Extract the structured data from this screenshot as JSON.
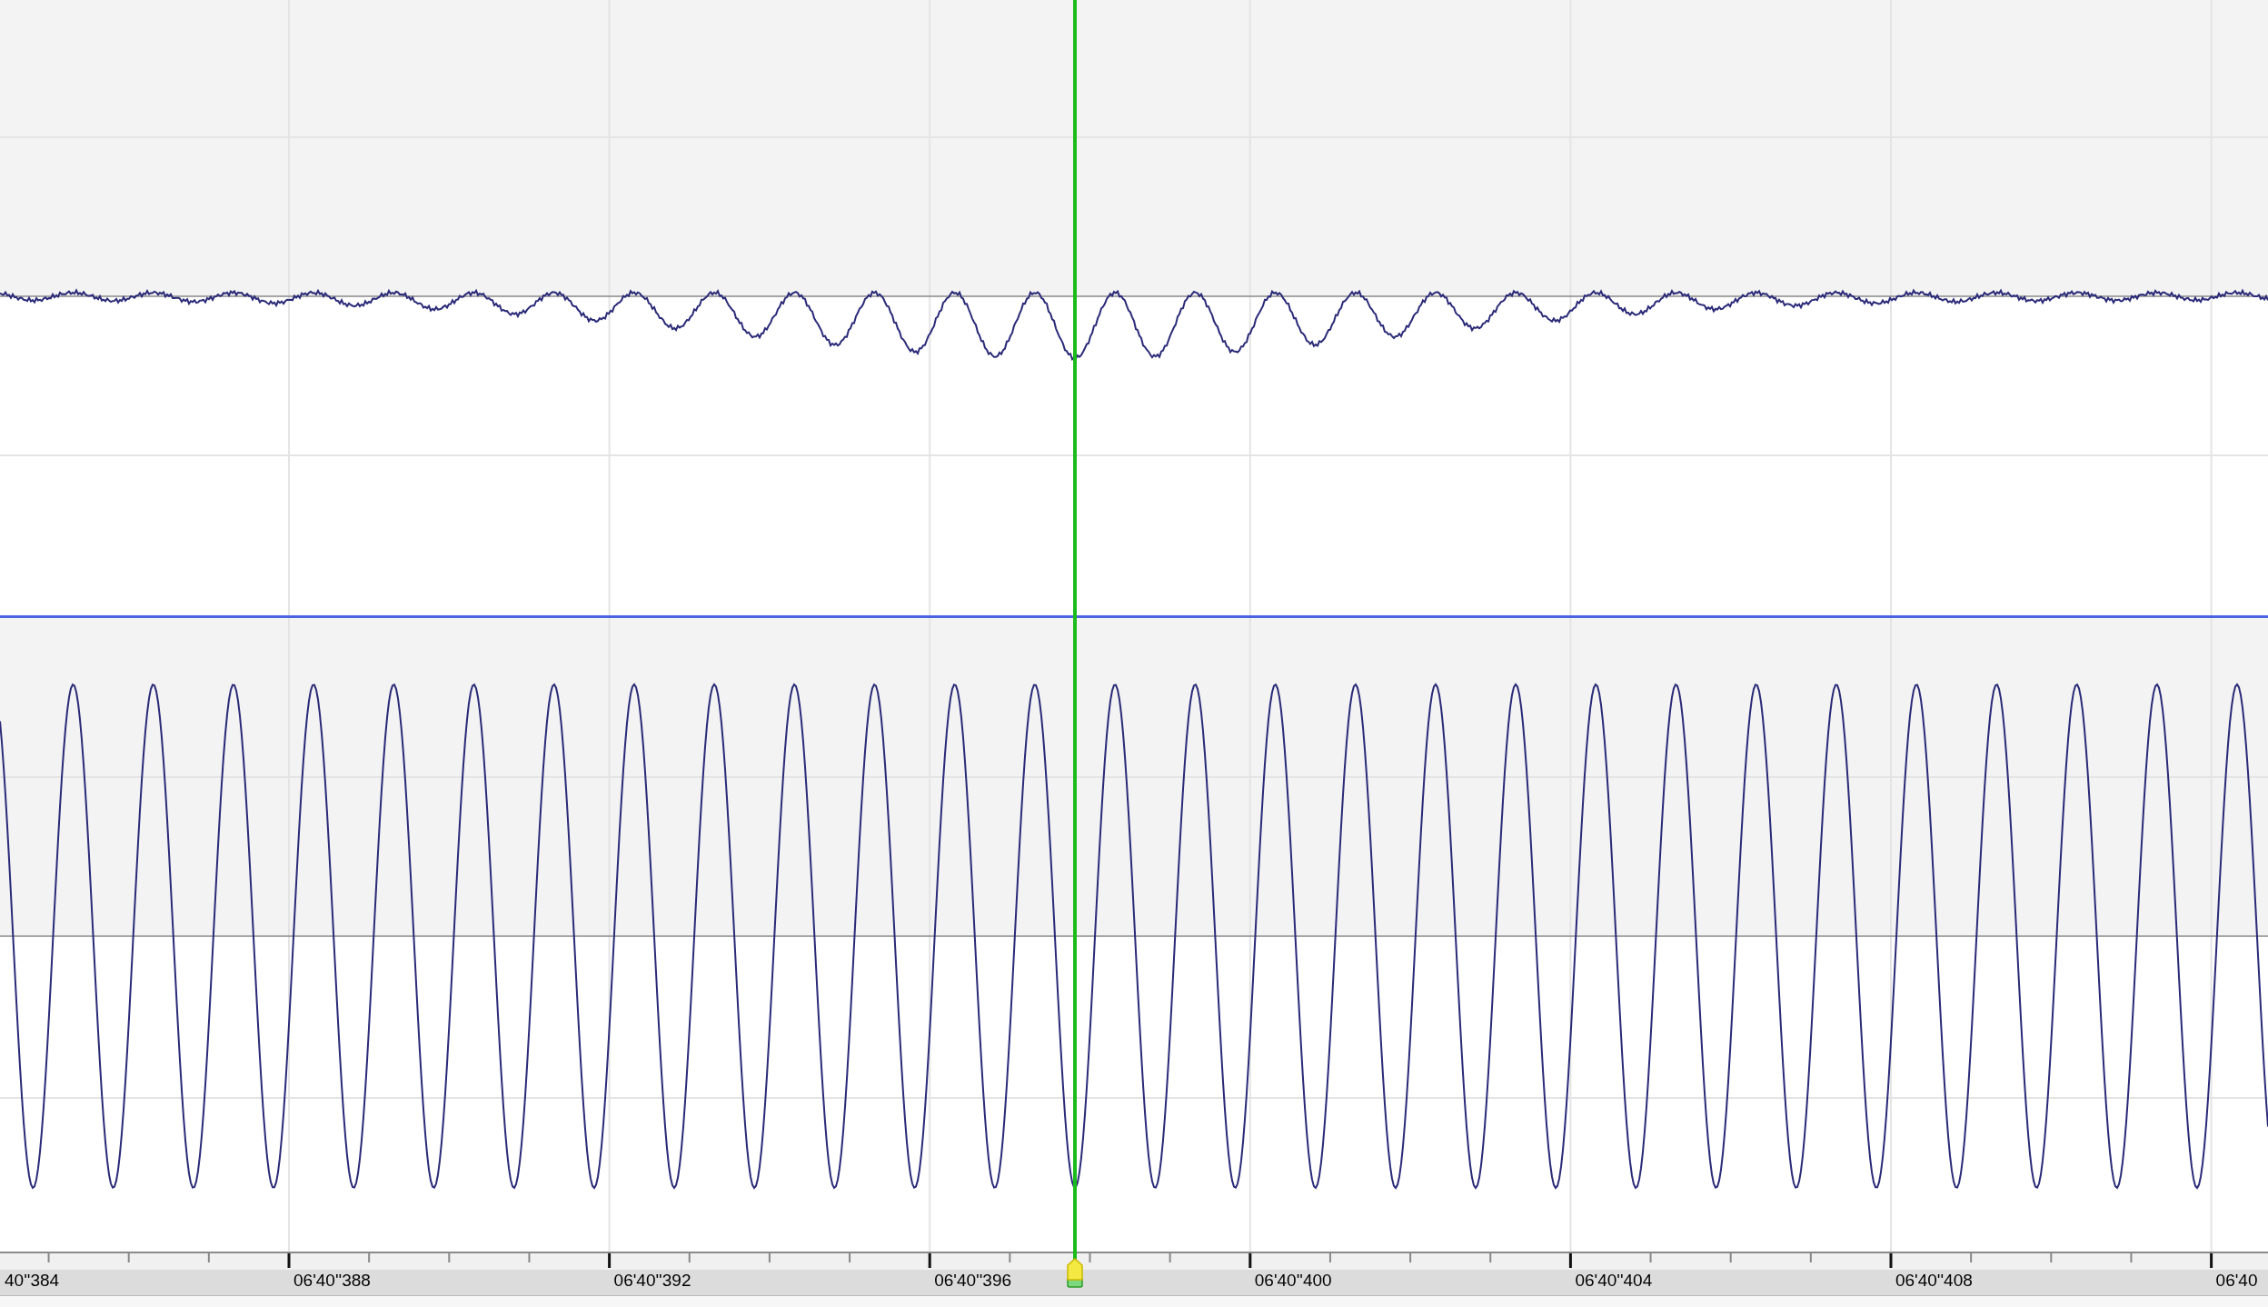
{
  "ruler": {
    "labels": [
      "40''384",
      "06'40''388",
      "06'40''392",
      "06'40''396",
      "06'40''400",
      "06'40''404",
      "06'40''408",
      "06'40"
    ]
  }
}
